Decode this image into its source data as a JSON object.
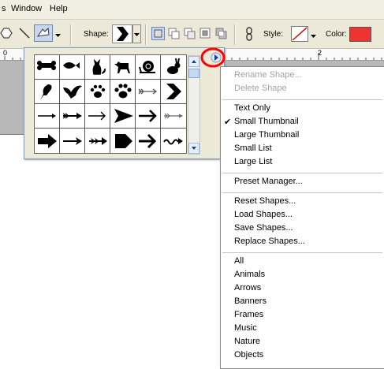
{
  "menubar": {
    "items": [
      {
        "label": "s"
      },
      {
        "label": "Window"
      },
      {
        "label": "Help"
      }
    ]
  },
  "toolbar": {
    "shape_label": "Shape:",
    "style_label": "Style:",
    "color_label": "Color:",
    "color_value": "#ee3333"
  },
  "ruler": {
    "labels": [
      "0",
      "2"
    ]
  },
  "shapes": [
    "bone",
    "fish",
    "cat",
    "dog",
    "snail",
    "rabbit",
    "bird",
    "dove",
    "paw-print",
    "paw-print-2",
    "arrow-feathered",
    "chevron",
    "arrow-thin",
    "arrow-tailed",
    "arrow-line",
    "arrow-triangle",
    "arrow-bold-line",
    "arrow-fletched",
    "arrow-block",
    "arrow-fine",
    "arrow-double-head",
    "pentagon-arrow",
    "arrow-heavy",
    "arrow-wavy"
  ],
  "menu": {
    "sections": [
      [
        {
          "label": "Rename Shape...",
          "disabled": true
        },
        {
          "label": "Delete Shape",
          "disabled": true
        }
      ],
      [
        {
          "label": "Text Only",
          "checked": false
        },
        {
          "label": "Small Thumbnail",
          "checked": true
        },
        {
          "label": "Large Thumbnail",
          "checked": false
        },
        {
          "label": "Small List",
          "checked": false
        },
        {
          "label": "Large List",
          "checked": false
        }
      ],
      [
        {
          "label": "Preset Manager..."
        }
      ],
      [
        {
          "label": "Reset Shapes..."
        },
        {
          "label": "Load Shapes..."
        },
        {
          "label": "Save Shapes..."
        },
        {
          "label": "Replace Shapes..."
        }
      ],
      [
        {
          "label": "All"
        },
        {
          "label": "Animals"
        },
        {
          "label": "Arrows"
        },
        {
          "label": "Banners"
        },
        {
          "label": "Frames"
        },
        {
          "label": "Music"
        },
        {
          "label": "Nature"
        },
        {
          "label": "Objects"
        }
      ]
    ]
  },
  "colors": {
    "highlight_ring": "#ff0000",
    "fill": "#ee3333"
  }
}
